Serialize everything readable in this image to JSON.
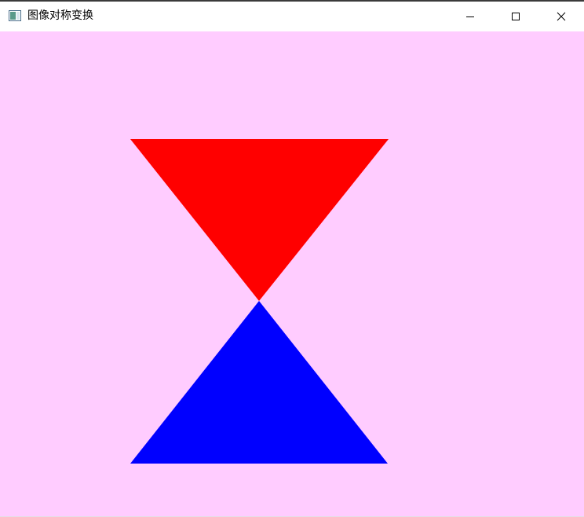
{
  "window": {
    "title": "图像对称变换",
    "app_icon": "app-window-icon",
    "controls": {
      "minimize_icon": "minimize-icon",
      "maximize_icon": "maximize-icon",
      "close_icon": "close-icon"
    }
  },
  "canvas": {
    "background": "#ffccff",
    "shapes": [
      {
        "name": "red-triangle",
        "fill": "#ff0000"
      },
      {
        "name": "blue-triangle",
        "fill": "#0000ff"
      }
    ]
  }
}
